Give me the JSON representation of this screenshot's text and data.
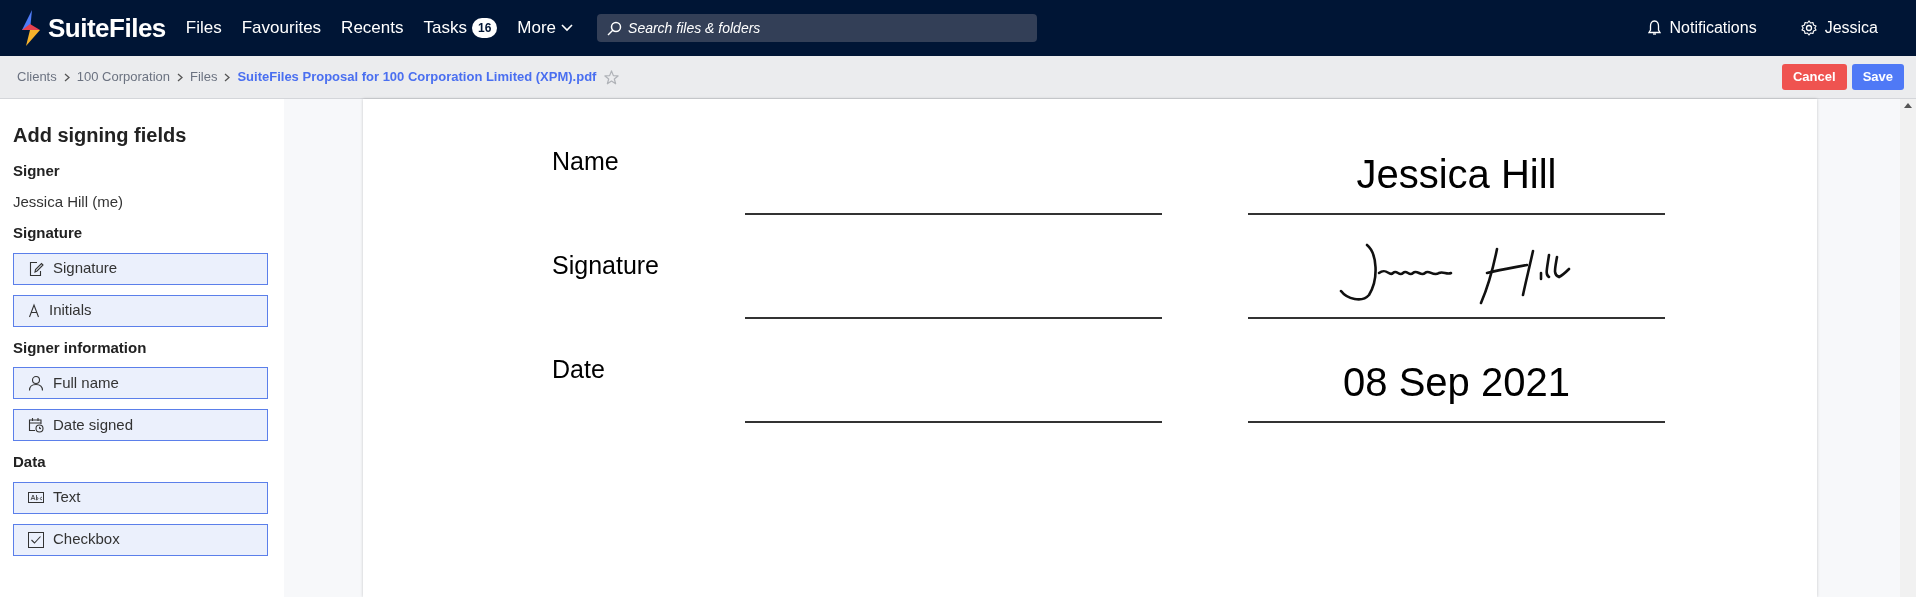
{
  "nav": {
    "logo": "SuiteFiles",
    "links": [
      {
        "label": "Files",
        "kind": "link"
      },
      {
        "label": "Favourites",
        "kind": "link"
      },
      {
        "label": "Recents",
        "kind": "link"
      },
      {
        "label": "Tasks",
        "kind": "link",
        "badge": "16"
      },
      {
        "label": "More",
        "kind": "dropdown"
      }
    ],
    "search": {
      "placeholder": "Search files & folders"
    },
    "notifications": "Notifications",
    "user": "Jessica"
  },
  "breadcrumb": {
    "items": [
      "Clients",
      "100 Corporation",
      "Files"
    ],
    "current": "SuiteFiles Proposal for 100 Corporation Limited (XPM).pdf",
    "starred": false
  },
  "actions": [
    {
      "label": "Cancel",
      "kind": "cancel"
    },
    {
      "label": "Save",
      "kind": "save"
    }
  ],
  "sidebar": {
    "title": "Add signing fields",
    "sections": [
      {
        "heading": "Signer",
        "text": "Jessica Hill (me)"
      },
      {
        "heading": "Signature",
        "fields": [
          {
            "label": "Signature",
            "kind": "signature"
          },
          {
            "label": "Initials",
            "kind": "initials"
          }
        ]
      },
      {
        "heading": "Signer information",
        "fields": [
          {
            "label": "Full name",
            "kind": "person"
          },
          {
            "label": "Date signed",
            "kind": "date"
          }
        ]
      },
      {
        "heading": "Data",
        "fields": [
          {
            "label": "Text",
            "kind": "text"
          },
          {
            "label": "Checkbox",
            "kind": "checkbox"
          }
        ]
      }
    ]
  },
  "document": {
    "rows": [
      {
        "label": "Name",
        "kind": "text",
        "value": "Jessica Hill"
      },
      {
        "label": "Signature",
        "kind": "signature"
      },
      {
        "label": "Date",
        "kind": "text",
        "value": "08 Sep 2021"
      }
    ]
  }
}
